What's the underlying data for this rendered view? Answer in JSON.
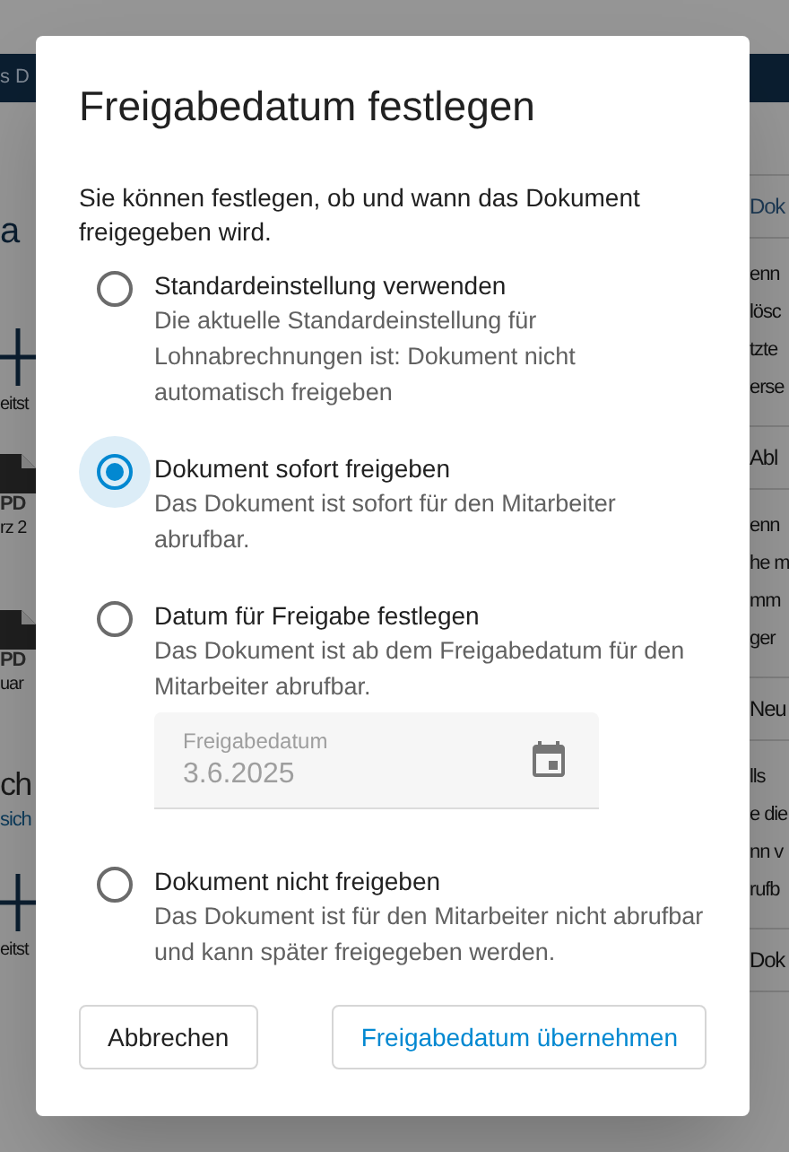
{
  "background": {
    "left": [
      {
        "kind": "header",
        "text": "s D"
      },
      {
        "kind": "heading",
        "text": "a"
      },
      {
        "kind": "add",
        "text": "eitst"
      },
      {
        "kind": "file",
        "badge": "PD",
        "text": "rz 2"
      },
      {
        "kind": "file",
        "badge": "PD",
        "text": "uar"
      },
      {
        "kind": "heading2",
        "text": "ch"
      },
      {
        "kind": "link",
        "text": "sich"
      },
      {
        "kind": "add",
        "text": "eitst"
      }
    ],
    "right": [
      {
        "kind": "header"
      },
      {
        "kind": "title",
        "text": "Dok",
        "link": true
      },
      {
        "kind": "para",
        "lines": [
          "enn",
          "lösc",
          "tzte",
          "erse"
        ]
      },
      {
        "kind": "title",
        "text": "Abl",
        "link": false
      },
      {
        "kind": "para",
        "lines": [
          "enn",
          "he m",
          "mm",
          "ger"
        ]
      },
      {
        "kind": "title",
        "text": "Neu",
        "link": false
      },
      {
        "kind": "para",
        "lines": [
          "lls",
          "e die",
          "nn v",
          "rufb"
        ]
      },
      {
        "kind": "title",
        "text": "Dok",
        "link": false
      }
    ]
  },
  "dialog": {
    "title": "Freigabedatum festlegen",
    "intro": "Sie können festlegen, ob und wann das Dokument freigegeben wird.",
    "options": [
      {
        "label": "Standardeinstellung verwenden",
        "description": "Die aktuelle Standardeinstellung für Lohnabrechnungen ist: Dokument nicht automatisch freigeben",
        "selected": false
      },
      {
        "label": "Dokument sofort freigeben",
        "description": "Das Dokument ist sofort für den Mitarbeiter abrufbar.",
        "selected": true
      },
      {
        "label": "Datum für Freigabe festlegen",
        "description": "Das Dokument ist ab dem Freigabedatum für den Mitarbeiter abrufbar.",
        "selected": false,
        "date_field": {
          "label": "Freigabedatum",
          "value": "3.6.2025",
          "disabled": true
        }
      },
      {
        "label": "Dokument nicht freigeben",
        "description": "Das Dokument ist für den Mitarbeiter nicht abrufbar und kann später freigegeben werden.",
        "selected": false
      }
    ],
    "buttons": [
      {
        "label": "Abbrechen",
        "kind": "neutral"
      },
      {
        "label": "Freigabedatum übernehmen",
        "kind": "primary"
      }
    ]
  }
}
